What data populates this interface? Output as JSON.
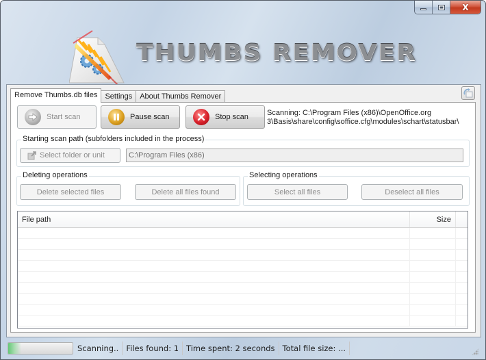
{
  "window": {
    "title": "Thumbs Remover",
    "controls": {
      "minimize": "minimize",
      "maximize": "maximize",
      "close": "X"
    }
  },
  "banner": {
    "title": "THUMBS REMOVER"
  },
  "tabs": [
    {
      "label": "Remove Thumbs.db files",
      "active": true
    },
    {
      "label": "Settings",
      "active": false
    },
    {
      "label": "About Thumbs Remover",
      "active": false
    }
  ],
  "scan_buttons": {
    "start": {
      "label": "Start scan",
      "icon": "arrow-right-icon",
      "enabled": false
    },
    "pause": {
      "label": "Pause scan",
      "icon": "pause-icon",
      "enabled": true
    },
    "stop": {
      "label": "Stop scan",
      "icon": "stop-x-icon",
      "enabled": true
    }
  },
  "scan_status": {
    "line1": "Scanning: C:\\Program Files (x86)\\OpenOffice.org",
    "line2": "3\\Basis\\share\\config\\soffice.cfg\\modules\\schart\\statusbar\\"
  },
  "scan_path_group": {
    "label": "Starting scan path (subfolders included in the process)",
    "select_button": "Select folder or unit",
    "path_value": "C:\\Program Files (x86)"
  },
  "deleting_group": {
    "label": "Deleting operations",
    "delete_selected": "Delete selected files",
    "delete_all": "Delete all files found"
  },
  "selecting_group": {
    "label": "Selecting operations",
    "select_all": "Select all files",
    "deselect_all": "Deselect all files"
  },
  "file_list": {
    "columns": [
      "File path",
      "Size"
    ],
    "rows": []
  },
  "statusbar": {
    "progress_fraction": 0.2,
    "state": "Scanning..",
    "files_found": "Files found: 1",
    "time_spent": "Time spent: 2 seconds",
    "total_size": "Total file size: ..."
  },
  "colors": {
    "close_button": "#c8432a",
    "progress_fill": "#56c46a",
    "pause_icon": "#d18a0e",
    "stop_icon": "#d2232a"
  }
}
